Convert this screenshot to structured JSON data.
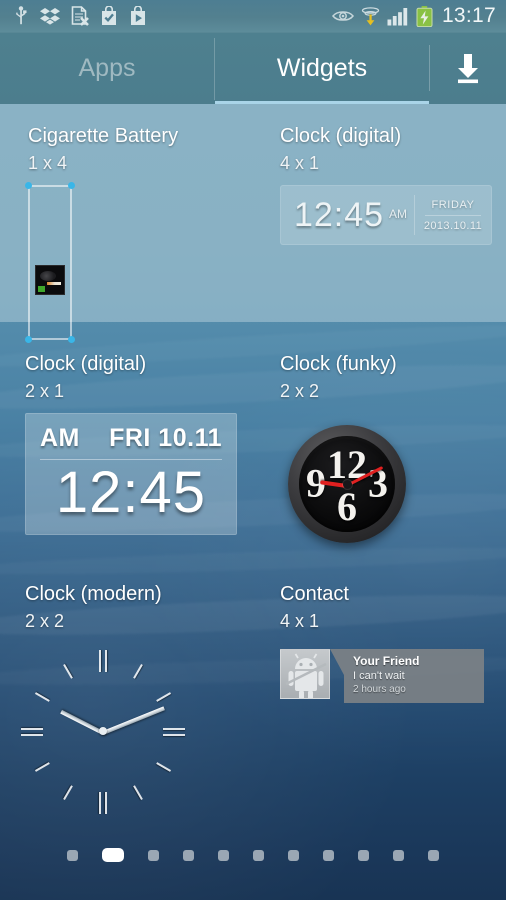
{
  "statusbar": {
    "time": "13:17",
    "left_icons": [
      "usb-icon",
      "dropbox-icon",
      "document-error-icon",
      "shopping-bag-check-icon",
      "play-store-icon"
    ],
    "right_icons": [
      "eye-icon",
      "download-manager-icon",
      "signal-bars-icon",
      "battery-charging-icon"
    ]
  },
  "tabs": {
    "apps_label": "Apps",
    "widgets_label": "Widgets",
    "active": "Widgets",
    "download_icon": "download-icon",
    "accent_color": "#a9d4e8"
  },
  "widgets": [
    {
      "title": "Cigarette Battery",
      "size": "1 x 4",
      "preview": "cigarette-battery-preview"
    },
    {
      "title": "Clock (digital)",
      "size": "4 x 1",
      "preview": "digital-clock-4x1-preview",
      "time": "12:45",
      "ampm": "AM",
      "day": "FRIDAY",
      "date": "2013.10.11"
    },
    {
      "title": "Clock (digital)",
      "size": "2 x 1",
      "preview": "digital-clock-2x1-preview",
      "ampm": "AM",
      "date": "FRI 10.11",
      "time": "12:45"
    },
    {
      "title": "Clock (funky)",
      "size": "2 x 2",
      "preview": "funky-analog-clock-preview",
      "numerals": [
        "12",
        "3",
        "6",
        "9"
      ],
      "hand_color": "#e02020"
    },
    {
      "title": "Clock (modern)",
      "size": "2 x 2",
      "preview": "modern-analog-clock-preview"
    },
    {
      "title": "Contact",
      "size": "4 x 1",
      "preview": "contact-widget-preview",
      "contact_name": "Your Friend",
      "contact_message": "I can't wait",
      "contact_time": "2 hours ago"
    }
  ],
  "pager": {
    "total_pages": 11,
    "active_page": 2
  }
}
